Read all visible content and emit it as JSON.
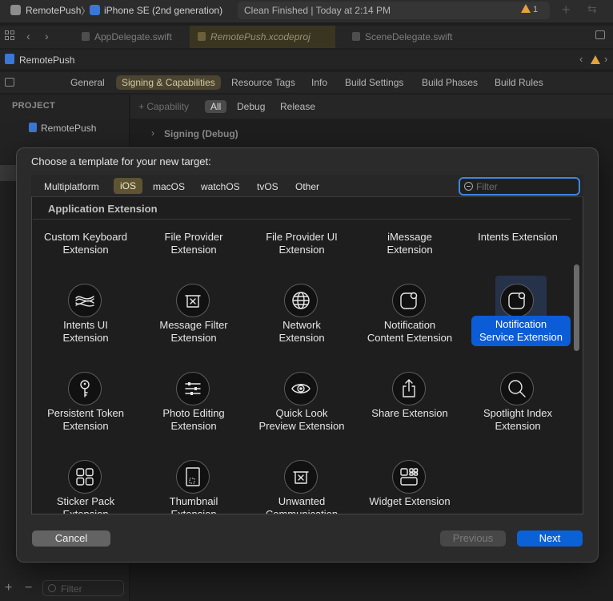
{
  "toolbar": {
    "scheme": "RemotePush",
    "device": "iPhone SE (2nd generation)",
    "status": "Clean Finished | Today at 2:14 PM",
    "warning_count": "1"
  },
  "tabs": [
    "AppDelegate.swift",
    "RemotePush.xcodeproj",
    "SceneDelegate.swift"
  ],
  "project": {
    "name": "RemotePush"
  },
  "settings_tabs": [
    "General",
    "Signing & Capabilities",
    "Resource Tags",
    "Info",
    "Build Settings",
    "Build Phases",
    "Build Rules"
  ],
  "left": {
    "heading": "PROJECT",
    "item": "RemotePush",
    "filter_placeholder": "Filter"
  },
  "editor": {
    "capability": "+ Capability",
    "segments": [
      "All",
      "Debug",
      "Release"
    ],
    "signing": "Signing (Debug)"
  },
  "dialog": {
    "title": "Choose a template for your new target:",
    "platforms": [
      "Multiplatform",
      "iOS",
      "macOS",
      "watchOS",
      "tvOS",
      "Other"
    ],
    "selected_platform": "iOS",
    "filter_placeholder": "Filter",
    "section": "Application Extension",
    "templates": [
      {
        "line1": "Custom Keyboard",
        "line2": "Extension",
        "icon": "none"
      },
      {
        "line1": "File Provider",
        "line2": "Extension",
        "icon": "none"
      },
      {
        "line1": "File Provider UI",
        "line2": "Extension",
        "icon": "none"
      },
      {
        "line1": "iMessage",
        "line2": "Extension",
        "icon": "none"
      },
      {
        "line1": "Intents Extension",
        "line2": "",
        "icon": "none"
      },
      {
        "line1": "Intents UI",
        "line2": "Extension",
        "icon": "waves-icon"
      },
      {
        "line1": "Message Filter",
        "line2": "Extension",
        "icon": "filter-tray-icon"
      },
      {
        "line1": "Network",
        "line2": "Extension",
        "icon": "globe-icon"
      },
      {
        "line1": "Notification",
        "line2": "Content Extension",
        "icon": "notification-icon"
      },
      {
        "line1": "Notification",
        "line2": "Service Extension",
        "icon": "notification-icon",
        "selected": true
      },
      {
        "line1": "Persistent Token",
        "line2": "Extension",
        "icon": "key-icon"
      },
      {
        "line1": "Photo Editing",
        "line2": "Extension",
        "icon": "sliders-icon"
      },
      {
        "line1": "Quick Look",
        "line2": "Preview Extension",
        "icon": "eye-icon"
      },
      {
        "line1": "Share Extension",
        "line2": "",
        "icon": "share-icon"
      },
      {
        "line1": "Spotlight Index",
        "line2": "Extension",
        "icon": "magnifier-icon"
      },
      {
        "line1": "Sticker Pack",
        "line2": "Extension",
        "icon": "grid-icon"
      },
      {
        "line1": "Thumbnail",
        "line2": "Extension",
        "icon": "thumbnail-icon"
      },
      {
        "line1": "Unwanted",
        "line2": "Communication",
        "icon": "filter-tray-icon"
      },
      {
        "line1": "Widget Extension",
        "line2": "",
        "icon": "widget-icon"
      }
    ],
    "cancel": "Cancel",
    "previous": "Previous",
    "next": "Next"
  },
  "colors": {
    "accent": "#0b62d6",
    "selected_tab": "#4a4430",
    "warning": "#e3a23b"
  }
}
